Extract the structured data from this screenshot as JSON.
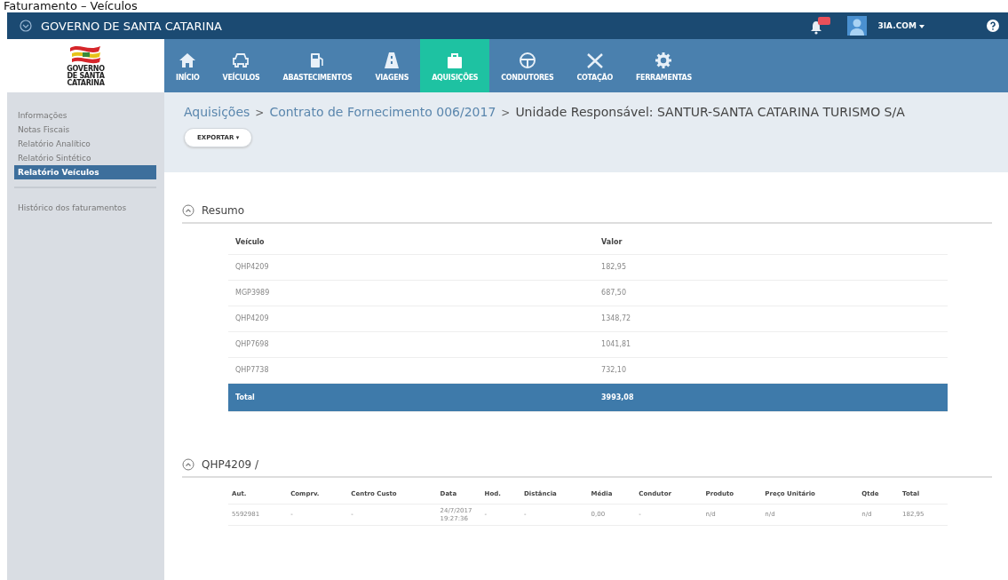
{
  "page_title": "Faturamento – Veículos",
  "top_bar": {
    "title": "GOVERNO DE SANTA CATARINA",
    "user": "3IA.COM"
  },
  "logo": {
    "lines": [
      "GOVERNO",
      "DE SANTA",
      "CATARINA"
    ]
  },
  "nav": [
    {
      "label": "INÍCIO",
      "selected": false
    },
    {
      "label": "VEÍCULOS",
      "selected": false
    },
    {
      "label": "ABASTECIMENTOS",
      "selected": false
    },
    {
      "label": "VIAGENS",
      "selected": false
    },
    {
      "label": "AQUISIÇÕES",
      "selected": true
    },
    {
      "label": "CONDUTORES",
      "selected": false
    },
    {
      "label": "COTAÇÃO",
      "selected": false
    },
    {
      "label": "FERRAMENTAS",
      "selected": false
    }
  ],
  "sidebar": {
    "groups": [
      [
        {
          "label": "Informações",
          "selected": false
        },
        {
          "label": "Notas Fiscais",
          "selected": false
        },
        {
          "label": "Relatório Analítico",
          "selected": false
        },
        {
          "label": "Relatório Sintético",
          "selected": false
        },
        {
          "label": "Relatório Veículos",
          "selected": true
        }
      ],
      [
        {
          "label": "Histórico dos faturamentos",
          "selected": false
        }
      ]
    ]
  },
  "breadcrumb": [
    "Aquisições",
    "Contrato de Fornecimento 006/2017",
    "Unidade Responsável: SANTUR-SANTA CATARINA TURISMO S/A"
  ],
  "breadcrumb_separator": ">",
  "export_button": "EXPORTAR ▾",
  "summary": {
    "title": "Resumo",
    "expanded": true,
    "columns": [
      "Veículo",
      "Valor"
    ],
    "rows": [
      [
        "QHP4209",
        "182,95"
      ],
      [
        "MGP3989",
        "687,50"
      ],
      [
        "QHP4209",
        "1348,72"
      ],
      [
        "QHP7698",
        "1041,81"
      ],
      [
        "QHP7738",
        "732,10"
      ]
    ],
    "total": [
      "Total",
      "3993,08"
    ]
  },
  "detail": {
    "title": "QHP4209 /",
    "expanded": true,
    "columns": [
      "Aut.",
      "Comprv.",
      "Centro Custo",
      "Data",
      "Hod.",
      "Distância",
      "Média",
      "Condutor",
      "Produto",
      "Preço Unitário",
      "Qtde",
      "Total"
    ],
    "rows": [
      [
        "5592981",
        "-",
        "-",
        "24/7/2017 19:27:36",
        "-",
        "-",
        "0,00",
        "-",
        "n/d",
        "n/d",
        "n/d",
        "182,95"
      ]
    ]
  }
}
